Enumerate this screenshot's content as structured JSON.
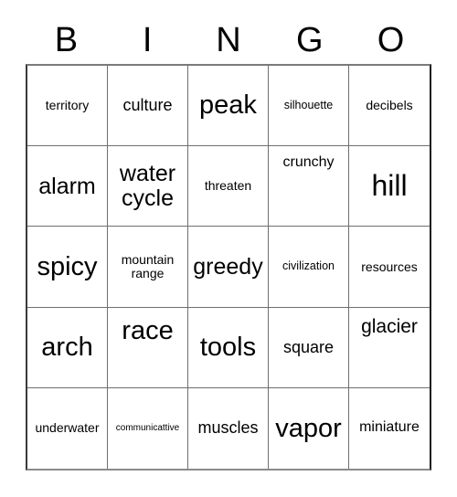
{
  "header": {
    "letters": [
      "B",
      "I",
      "N",
      "G",
      "O"
    ]
  },
  "grid": {
    "columns": 5,
    "rows": 5,
    "cells": [
      {
        "text": "territory",
        "size": "s",
        "align": "center",
        "lines": 1
      },
      {
        "text": "culture",
        "size": "ml",
        "align": "center",
        "lines": 1
      },
      {
        "text": "peak",
        "size": "xxl",
        "align": "center",
        "lines": 1
      },
      {
        "text": "silhouette",
        "size": "xs",
        "align": "center",
        "lines": 1
      },
      {
        "text": "decibels",
        "size": "s",
        "align": "center",
        "lines": 1
      },
      {
        "text": "alarm",
        "size": "xl",
        "align": "center",
        "lines": 1
      },
      {
        "text": "water cycle",
        "size": "xl",
        "align": "center",
        "lines": 2
      },
      {
        "text": "threaten",
        "size": "s",
        "align": "center",
        "lines": 1
      },
      {
        "text": "crunchy",
        "size": "m",
        "align": "upper",
        "lines": 1
      },
      {
        "text": "hill",
        "size": "xxxl",
        "align": "center",
        "lines": 1
      },
      {
        "text": "spicy",
        "size": "xxl",
        "align": "center",
        "lines": 1
      },
      {
        "text": "mountain range",
        "size": "s",
        "align": "center",
        "lines": 2
      },
      {
        "text": "greedy",
        "size": "xl",
        "align": "center",
        "lines": 1
      },
      {
        "text": "civilization",
        "size": "xs",
        "align": "center",
        "lines": 1
      },
      {
        "text": "resources",
        "size": "s",
        "align": "center",
        "lines": 1
      },
      {
        "text": "arch",
        "size": "xxl",
        "align": "center",
        "lines": 1
      },
      {
        "text": "race",
        "size": "xxl",
        "align": "upper",
        "lines": 1
      },
      {
        "text": "tools",
        "size": "xxl",
        "align": "center",
        "lines": 1
      },
      {
        "text": "square",
        "size": "ml",
        "align": "center",
        "lines": 1
      },
      {
        "text": "glacier",
        "size": "l",
        "align": "upper",
        "lines": 1
      },
      {
        "text": "underwater",
        "size": "s",
        "align": "center",
        "lines": 1
      },
      {
        "text": "communicattive",
        "size": "xxs",
        "align": "center",
        "lines": 1
      },
      {
        "text": "muscles",
        "size": "ml",
        "align": "center",
        "lines": 1
      },
      {
        "text": "vapor",
        "size": "xxl",
        "align": "center",
        "lines": 1
      },
      {
        "text": "miniature",
        "size": "m",
        "align": "center",
        "lines": 1
      }
    ]
  },
  "style": {
    "page_background": "#ffffff",
    "text_color": "#000000",
    "grid_line_color": "#6f6f6f",
    "grid_border_color": "#1a1a1a"
  }
}
